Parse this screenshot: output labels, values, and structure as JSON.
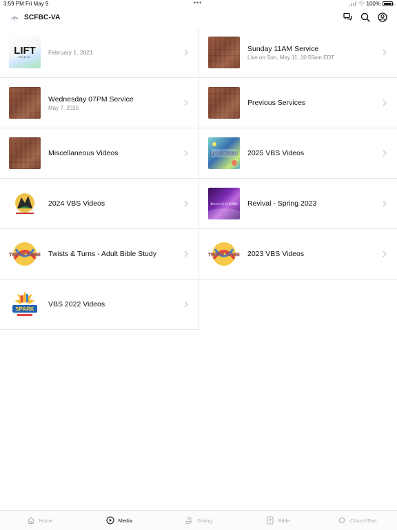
{
  "status": {
    "time": "3:59 PM",
    "date": "Fri May 9",
    "battery": "100%"
  },
  "header": {
    "title": "SCFBC-VA"
  },
  "items": [
    {
      "title": "",
      "subtitle": "February 1, 2021",
      "thumb_text": "LIFT",
      "thumb_sub": "RADIO"
    },
    {
      "title": "Sunday 11AM Service",
      "subtitle": "Live on Sun, May 11, 10:55am EDT"
    },
    {
      "title": "Wednesday 07PM Service",
      "subtitle": "May 7, 2025"
    },
    {
      "title": "Previous Services",
      "subtitle": ""
    },
    {
      "title": "Miscellaneous Videos",
      "subtitle": ""
    },
    {
      "title": "2025 VBS Videos",
      "subtitle": "",
      "thumb_text": "MAGNIFIED"
    },
    {
      "title": "2024 VBS Videos",
      "subtitle": ""
    },
    {
      "title": "Revival - Spring 2023",
      "subtitle": "",
      "thumb_text": "Revive Us O LORD"
    },
    {
      "title": "Twists & Turns - Adult Bible Study",
      "subtitle": "",
      "thumb_text": "TWISTS TURNS"
    },
    {
      "title": "2023 VBS Videos",
      "subtitle": "",
      "thumb_text": "TWISTS TURNS"
    },
    {
      "title": "VBS 2022 Videos",
      "subtitle": "",
      "thumb_text": "SPARK"
    }
  ],
  "tabs": [
    {
      "label": "Home",
      "icon": "home-icon"
    },
    {
      "label": "Media",
      "icon": "play-icon"
    },
    {
      "label": "Giving",
      "icon": "giving-icon"
    },
    {
      "label": "Bible",
      "icon": "bible-icon"
    },
    {
      "label": "ChurchTrac",
      "icon": "churchtrac-icon"
    }
  ],
  "active_tab": "Media"
}
